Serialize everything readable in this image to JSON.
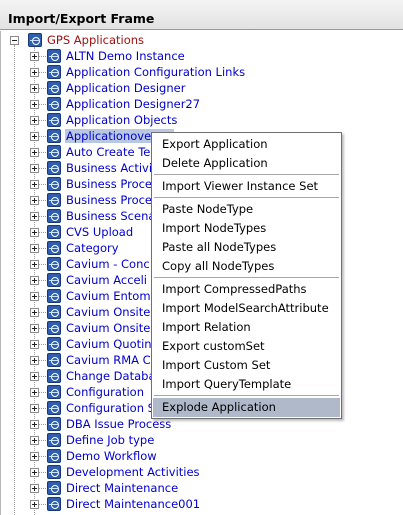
{
  "frame": {
    "title": "Import/Export Frame"
  },
  "tree": {
    "root": {
      "label": "GPS Applications",
      "expanded": true,
      "icon": "application-tree-icon"
    },
    "nodes": [
      {
        "label": "ALTN Demo Instance"
      },
      {
        "label": "Application Configuration Links"
      },
      {
        "label": "Application Designer"
      },
      {
        "label": "Application Designer27"
      },
      {
        "label": "Application Objects"
      },
      {
        "label": "Applicationoverv...",
        "selected": true
      },
      {
        "label": "Auto Create Te"
      },
      {
        "label": "Business Activi"
      },
      {
        "label": "Business Proce"
      },
      {
        "label": "Business Proce"
      },
      {
        "label": "Business Scena"
      },
      {
        "label": "CVS Upload"
      },
      {
        "label": "Category"
      },
      {
        "label": "Cavium - Conc"
      },
      {
        "label": "Cavium Acceli"
      },
      {
        "label": "Cavium Entom"
      },
      {
        "label": "Cavium Onsite"
      },
      {
        "label": "Cavium Onsite"
      },
      {
        "label": "Cavium Quotin"
      },
      {
        "label": "Cavium RMA C"
      },
      {
        "label": "Change Databa"
      },
      {
        "label": "Configuration"
      },
      {
        "label": "Configuration S"
      },
      {
        "label": "DBA Issue Process"
      },
      {
        "label": "Define Job type"
      },
      {
        "label": "Demo Workflow"
      },
      {
        "label": "Development Activities"
      },
      {
        "label": "Direct Maintenance"
      },
      {
        "label": "Direct Maintenance001"
      }
    ]
  },
  "context_menu": {
    "groups": [
      {
        "items": [
          "Export Application",
          "Delete Application"
        ]
      },
      {
        "items": [
          "Import Viewer Instance Set"
        ]
      },
      {
        "items": [
          "Paste NodeType",
          "Import NodeTypes",
          "Paste all NodeTypes",
          "Copy all NodeTypes"
        ]
      },
      {
        "items": [
          "Import CompressedPaths",
          "Import ModelSearchAttribute",
          "Import Relation",
          "Export customSet",
          "Import Custom Set",
          "Import QueryTemplate"
        ]
      },
      {
        "items": [
          "Explode Application"
        ]
      }
    ],
    "hovered_item": "Explode Application"
  },
  "colors": {
    "link": "#0000cc",
    "root_label": "#a01010",
    "selection": "#b9c8e2",
    "menu_hover": "#b0b9ca",
    "node_icon": "#2d5fae"
  }
}
